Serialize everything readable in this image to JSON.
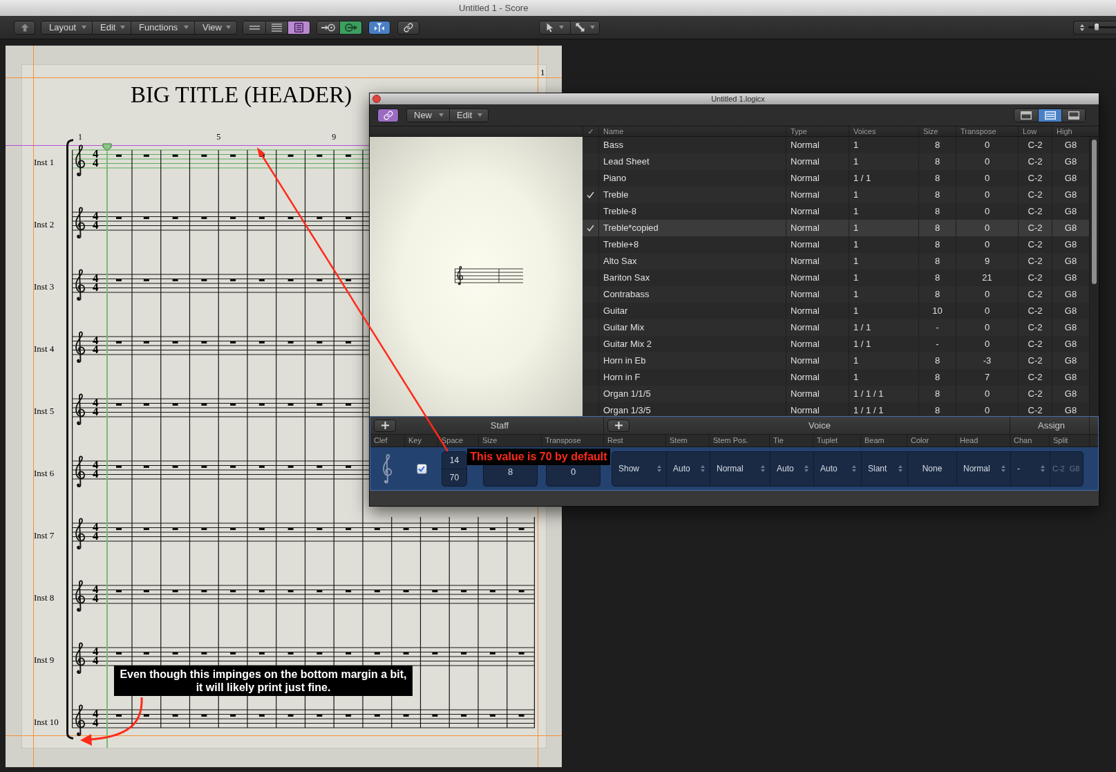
{
  "window": {
    "title": "Untitled 1 - Score"
  },
  "toolbar": {
    "menus": [
      {
        "label": "Layout"
      },
      {
        "label": "Edit"
      },
      {
        "label": "Functions"
      },
      {
        "label": "View"
      }
    ],
    "display_buttons": [
      {
        "selected": false
      },
      {
        "selected": false
      },
      {
        "selected": true
      }
    ],
    "arrow_buttons": [
      {
        "selected": false
      },
      {
        "selected": true
      }
    ],
    "split_button": {
      "on": true
    },
    "link_button": {
      "on": false
    },
    "zoom_slider": {
      "level": 0.3
    }
  },
  "score": {
    "page_number": "1",
    "title": "BIG TITLE (HEADER)",
    "measure_numbers": [
      "1",
      "5",
      "9"
    ],
    "staves": [
      {
        "name": "Inst 1",
        "selected": true,
        "meter": [
          "4",
          "4"
        ]
      },
      {
        "name": "Inst 2",
        "selected": false,
        "meter": [
          "4",
          "4"
        ]
      },
      {
        "name": "Inst 3",
        "selected": false,
        "meter": [
          "4",
          "4"
        ]
      },
      {
        "name": "Inst 4",
        "selected": false,
        "meter": [
          "4",
          "4"
        ]
      },
      {
        "name": "Inst 5",
        "selected": false,
        "meter": [
          "4",
          "4"
        ]
      },
      {
        "name": "Inst 6",
        "selected": false,
        "meter": [
          "4",
          "4"
        ]
      },
      {
        "name": "Inst 7",
        "selected": false,
        "meter": [
          "4",
          "4"
        ]
      },
      {
        "name": "Inst 8",
        "selected": false,
        "meter": [
          "4",
          "4"
        ]
      },
      {
        "name": "Inst 9",
        "selected": false,
        "meter": [
          "4",
          "4"
        ]
      },
      {
        "name": "Inst 10",
        "selected": false,
        "meter": [
          "4",
          "4"
        ]
      }
    ]
  },
  "styles_window": {
    "title": "Untitled 1.logicx",
    "link_button": {
      "on": true
    },
    "menus": [
      {
        "label": "New"
      },
      {
        "label": "Edit"
      }
    ],
    "layout_buttons": [
      {
        "selected": false
      },
      {
        "selected": true
      },
      {
        "selected": false
      }
    ],
    "table": {
      "columns": [
        "✓",
        "Name",
        "Type",
        "Voices",
        "Size",
        "Transpose",
        "Low",
        "High"
      ],
      "rows": [
        {
          "checked": false,
          "selected": false,
          "name": "Bass",
          "type": "Normal",
          "voices": "1",
          "size": "8",
          "transpose": "0",
          "low": "C-2",
          "high": "G8"
        },
        {
          "checked": false,
          "selected": false,
          "name": "Lead Sheet",
          "type": "Normal",
          "voices": "1",
          "size": "8",
          "transpose": "0",
          "low": "C-2",
          "high": "G8"
        },
        {
          "checked": false,
          "selected": false,
          "name": "Piano",
          "type": "Normal",
          "voices": "1 / 1",
          "size": "8",
          "transpose": "0",
          "low": "C-2",
          "high": "G8"
        },
        {
          "checked": true,
          "selected": false,
          "name": "Treble",
          "type": "Normal",
          "voices": "1",
          "size": "8",
          "transpose": "0",
          "low": "C-2",
          "high": "G8"
        },
        {
          "checked": false,
          "selected": false,
          "name": "Treble-8",
          "type": "Normal",
          "voices": "1",
          "size": "8",
          "transpose": "0",
          "low": "C-2",
          "high": "G8"
        },
        {
          "checked": true,
          "selected": true,
          "name": "Treble*copied",
          "type": "Normal",
          "voices": "1",
          "size": "8",
          "transpose": "0",
          "low": "C-2",
          "high": "G8"
        },
        {
          "checked": false,
          "selected": false,
          "name": "Treble+8",
          "type": "Normal",
          "voices": "1",
          "size": "8",
          "transpose": "0",
          "low": "C-2",
          "high": "G8"
        },
        {
          "checked": false,
          "selected": false,
          "name": "Alto Sax",
          "type": "Normal",
          "voices": "1",
          "size": "8",
          "transpose": "9",
          "low": "C-2",
          "high": "G8"
        },
        {
          "checked": false,
          "selected": false,
          "name": "Bariton Sax",
          "type": "Normal",
          "voices": "1",
          "size": "8",
          "transpose": "21",
          "low": "C-2",
          "high": "G8"
        },
        {
          "checked": false,
          "selected": false,
          "name": "Contrabass",
          "type": "Normal",
          "voices": "1",
          "size": "8",
          "transpose": "0",
          "low": "C-2",
          "high": "G8"
        },
        {
          "checked": false,
          "selected": false,
          "name": "Guitar",
          "type": "Normal",
          "voices": "1",
          "size": "10",
          "transpose": "0",
          "low": "C-2",
          "high": "G8"
        },
        {
          "checked": false,
          "selected": false,
          "name": "Guitar Mix",
          "type": "Normal",
          "voices": "1 / 1",
          "size": "-",
          "transpose": "0",
          "low": "C-2",
          "high": "G8"
        },
        {
          "checked": false,
          "selected": false,
          "name": "Guitar Mix 2",
          "type": "Normal",
          "voices": "1 / 1",
          "size": "-",
          "transpose": "0",
          "low": "C-2",
          "high": "G8"
        },
        {
          "checked": false,
          "selected": false,
          "name": "Horn in Eb",
          "type": "Normal",
          "voices": "1",
          "size": "8",
          "transpose": "-3",
          "low": "C-2",
          "high": "G8"
        },
        {
          "checked": false,
          "selected": false,
          "name": "Horn in F",
          "type": "Normal",
          "voices": "1",
          "size": "8",
          "transpose": "7",
          "low": "C-2",
          "high": "G8"
        },
        {
          "checked": false,
          "selected": false,
          "name": "Organ 1/1/5",
          "type": "Normal",
          "voices": "1 / 1 / 1",
          "size": "8",
          "transpose": "0",
          "low": "C-2",
          "high": "G8"
        },
        {
          "checked": false,
          "selected": false,
          "name": "Organ 1/3/5",
          "type": "Normal",
          "voices": "1 / 1 / 1",
          "size": "8",
          "transpose": "0",
          "low": "C-2",
          "high": "G8"
        }
      ]
    },
    "staff_panel": {
      "groups": [
        {
          "label": "Staff",
          "add_button": true
        },
        {
          "label": "Voice",
          "add_button": true
        },
        {
          "label": "Assign",
          "add_button": false
        }
      ],
      "columns": [
        {
          "label": "Clef",
          "kind": "clef"
        },
        {
          "label": "Key",
          "kind": "checkbox",
          "checked": true
        },
        {
          "label": "Space",
          "kind": "pair",
          "values": [
            "14",
            "70"
          ]
        },
        {
          "label": "Size",
          "kind": "number",
          "value": "8"
        },
        {
          "label": "Transpose",
          "kind": "number",
          "value": "0"
        },
        {
          "label": "Rest",
          "kind": "popup",
          "value": "Show"
        },
        {
          "label": "Stem",
          "kind": "popup",
          "value": "Auto"
        },
        {
          "label": "Stem Pos.",
          "kind": "popup",
          "value": "Normal"
        },
        {
          "label": "Tie",
          "kind": "popup",
          "value": "Auto"
        },
        {
          "label": "Tuplet",
          "kind": "popup",
          "value": "Auto"
        },
        {
          "label": "Beam",
          "kind": "popup",
          "value": "Slant"
        },
        {
          "label": "Color",
          "kind": "value",
          "value": "None"
        },
        {
          "label": "Head",
          "kind": "popup",
          "value": "Normal"
        },
        {
          "label": "Chan",
          "kind": "popup",
          "value": "-"
        },
        {
          "label": "Split",
          "kind": "range",
          "values": [
            "C-2",
            "G8"
          ],
          "disabled": true
        }
      ]
    }
  },
  "annotations": [
    {
      "kind": "callout",
      "text": "This value is 70 by default"
    },
    {
      "kind": "note",
      "text": "Even though this impinges on the bottom margin a bit, it will likely print just fine."
    }
  ]
}
